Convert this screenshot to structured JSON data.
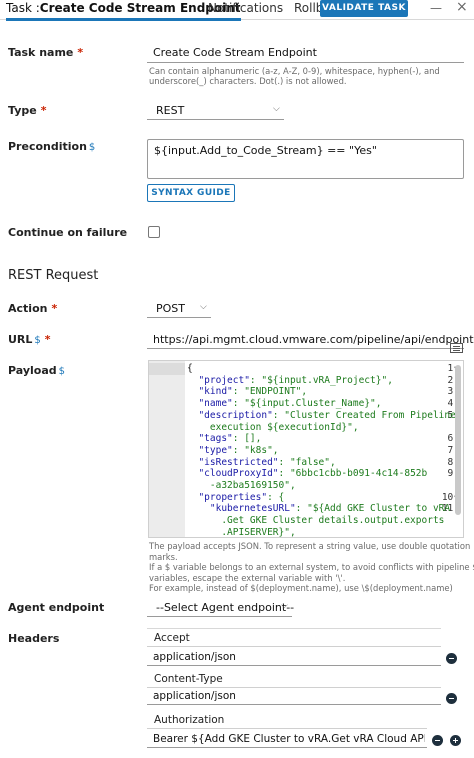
{
  "tabs": {
    "active_prefix": "Task :",
    "active_name": "Create Code Stream Endpoint",
    "notifications": "Notifications",
    "rollback": "Rollback",
    "validate": "VALIDATE TASK",
    "minimize": "—",
    "close": "×"
  },
  "task_name": {
    "label": "Task name",
    "required": "*",
    "value": "Create Code Stream Endpoint",
    "helper_line1": "Can contain alphanumeric (a-z, A-Z, 0-9), whitespace, hyphen(-), and",
    "helper_line2": "underscore(_) characters. Dot(.) is not allowed."
  },
  "type": {
    "label": "Type",
    "required": "*",
    "value": "REST"
  },
  "precondition": {
    "label": "Precondition",
    "dollar": "$",
    "value": "${input.Add_to_Code_Stream} == \"Yes\"",
    "syntax_guide": "SYNTAX GUIDE"
  },
  "continue_on_failure": {
    "label": "Continue on failure",
    "checked": false
  },
  "rest_request": {
    "title": "REST Request",
    "action_label": "Action",
    "action_required": "*",
    "action_value": "POST",
    "url_label": "URL",
    "url_dollar": "$",
    "url_required": "*",
    "url_value": "https://api.mgmt.cloud.vmware.com/pipeline/api/endpoints",
    "payload_label": "Payload",
    "payload_dollar": "$"
  },
  "payload_editor": {
    "line_numbers": [
      "1",
      "2",
      "3",
      "4",
      "5",
      "",
      "6",
      "7",
      "8",
      "9",
      "",
      "10",
      "11",
      "",
      ""
    ],
    "fold_markers": [
      "1",
      "10"
    ],
    "lines": [
      {
        "key": "",
        "rest": "{"
      },
      {
        "key": "  \"project\"",
        "rest": ": \"${input.vRA_Project}\","
      },
      {
        "key": "  \"kind\"",
        "rest": ": \"ENDPOINT\","
      },
      {
        "key": "  \"name\"",
        "rest": ": \"${input.Cluster_Name}\","
      },
      {
        "key": "  \"description\"",
        "rest": ": \"Cluster Created From Pipeline"
      },
      {
        "key": "",
        "rest": "    execution ${executionId}\","
      },
      {
        "key": "  \"tags\"",
        "rest": ": [],"
      },
      {
        "key": "  \"type\"",
        "rest": ": \"k8s\","
      },
      {
        "key": "  \"isRestricted\"",
        "rest": ": \"false\","
      },
      {
        "key": "  \"cloudProxyId\"",
        "rest": ": \"6bbc1cbb-b091-4c14-852b"
      },
      {
        "key": "",
        "rest": "    -a32ba5169150\","
      },
      {
        "key": "  \"properties\"",
        "rest": ": {"
      },
      {
        "key": "    \"kubernetesURL\"",
        "rest": ": \"${Add GKE Cluster to vRA"
      },
      {
        "key": "",
        "rest": "      .Get GKE Cluster details.output.exports"
      },
      {
        "key": "",
        "rest": "      .APISERVER}\","
      }
    ]
  },
  "payload_help": {
    "line1": "The payload accepts JSON. To represent a string value, use double quotation",
    "line2": "marks.",
    "line3": "If a $ variable belongs to an external system, to avoid conflicts with pipeline $",
    "line4": "variables, escape the external variable with '\\'.",
    "line5": "For example, instead of $(deployment.name), use \\$(deployment.name)"
  },
  "agent_endpoint": {
    "label": "Agent endpoint",
    "value": "--Select Agent endpoint--"
  },
  "headers": {
    "label": "Headers",
    "items": [
      {
        "key": "Accept",
        "value": "application/json"
      },
      {
        "key": "Content-Type",
        "value": "application/json"
      },
      {
        "key": "Authorization",
        "value": "Bearer ${Add GKE Cluster to vRA.Get vRA Cloud API Toke"
      }
    ]
  },
  "colors": {
    "accent": "#1b76b8",
    "required": "#c92100",
    "icon_dark": "#1e2f3d"
  }
}
